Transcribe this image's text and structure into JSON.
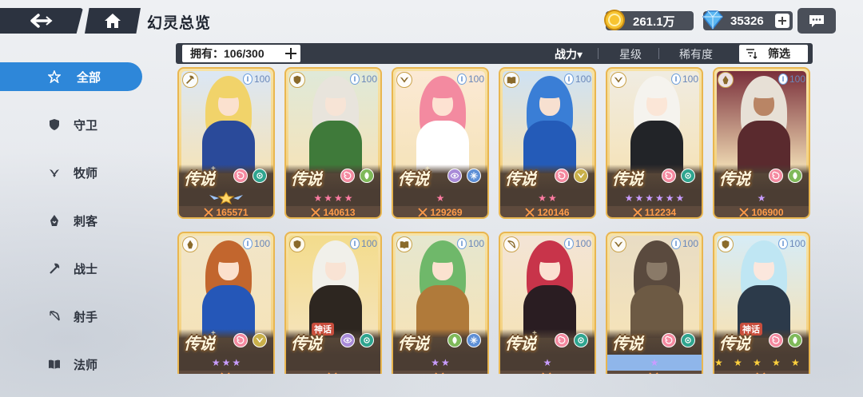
{
  "header": {
    "title": "幻灵总览",
    "gold": "261.1万",
    "gems": "35326"
  },
  "sidebar": {
    "items": [
      {
        "label": "全部",
        "icon": "all-star-icon",
        "active": true
      },
      {
        "label": "守卫",
        "icon": "shield-icon",
        "active": false
      },
      {
        "label": "牧师",
        "icon": "wing-icon",
        "active": false
      },
      {
        "label": "刺客",
        "icon": "assassin-icon",
        "active": false
      },
      {
        "label": "战士",
        "icon": "axe-icon",
        "active": false
      },
      {
        "label": "射手",
        "icon": "bow-icon",
        "active": false
      },
      {
        "label": "法师",
        "icon": "book-icon",
        "active": false
      }
    ]
  },
  "filterbar": {
    "own_label": "拥有：",
    "own_value": "106/300",
    "sort_power": "战力▾",
    "sort_star": "星级",
    "sort_rarity": "稀有度",
    "filter_label": "筛选"
  },
  "cards": [
    {
      "level": "100",
      "rarity": "传说",
      "sup": "+",
      "myth": "",
      "power": "165571",
      "stars": 0,
      "star_color": "gold",
      "star_bar": "dark",
      "elems": [
        "spiral",
        "orb"
      ],
      "class_icon": "axe-icon",
      "badge": true,
      "art": {
        "bg": "#dbe7f5",
        "hair": "#f1d36a",
        "skin": "#fbe1cf",
        "outfit": "#2a4a9a"
      }
    },
    {
      "level": "100",
      "rarity": "传说",
      "sup": "",
      "myth": "",
      "power": "140613",
      "stars": 4,
      "star_color": "pink",
      "star_bar": "dark",
      "elems": [
        "spiral",
        "leaf"
      ],
      "class_icon": "shield-icon",
      "badge": false,
      "art": {
        "bg": "#dfe9d9",
        "hair": "#e8e4dc",
        "skin": "#f7e4d6",
        "outfit": "#3f7a3a"
      }
    },
    {
      "level": "100",
      "rarity": "传说",
      "sup": "+",
      "myth": "",
      "power": "129269",
      "stars": 1,
      "star_color": "pink",
      "star_bar": "dark",
      "elems": [
        "eye",
        "snow"
      ],
      "class_icon": "wing-icon",
      "badge": false,
      "art": {
        "bg": "#fbe9d5",
        "hair": "#f38aa0",
        "skin": "#fde2d2",
        "outfit": "#ffffff"
      }
    },
    {
      "level": "100",
      "rarity": "传说",
      "sup": "",
      "myth": "",
      "power": "120146",
      "stars": 2,
      "star_color": "pink",
      "star_bar": "dark",
      "elems": [
        "spiral",
        "wing"
      ],
      "class_icon": "book-icon",
      "badge": false,
      "art": {
        "bg": "#cfe2f3",
        "hair": "#3a7ed6",
        "skin": "#f7e0d0",
        "outfit": "#245bb8"
      }
    },
    {
      "level": "100",
      "rarity": "传说",
      "sup": "",
      "myth": "",
      "power": "112234",
      "stars": 6,
      "star_color": "purple",
      "star_bar": "dark",
      "elems": [
        "spiral",
        "orb"
      ],
      "class_icon": "wing-icon",
      "badge": false,
      "art": {
        "bg": "#f0ece2",
        "hair": "#f5f3ee",
        "skin": "#fbe6d7",
        "outfit": "#222428"
      }
    },
    {
      "level": "100",
      "rarity": "传说",
      "sup": "",
      "myth": "",
      "power": "106900",
      "stars": 1,
      "star_color": "purple",
      "star_bar": "dark",
      "elems": [
        "spiral",
        "leaf"
      ],
      "class_icon": "assassin-icon",
      "badge": false,
      "art": {
        "bg": "#7a2f3b",
        "hair": "#e7e0d6",
        "skin": "#b98565",
        "outfit": "#5a2a2e"
      }
    },
    {
      "level": "100",
      "rarity": "传说",
      "sup": "+",
      "myth": "",
      "power": "",
      "stars": 3,
      "star_color": "purple",
      "star_bar": "dark",
      "elems": [
        "spiral",
        "wing"
      ],
      "class_icon": "assassin-icon",
      "badge": false,
      "art": {
        "bg": "#f1e5c8",
        "hair": "#c2662e",
        "skin": "#fbe0cc",
        "outfit": "#2557b8"
      }
    },
    {
      "level": "100",
      "rarity": "传说",
      "sup": "",
      "myth": "神话",
      "power": "",
      "stars": 0,
      "star_color": "purple",
      "star_bar": "dark",
      "elems": [
        "eye",
        "orb"
      ],
      "class_icon": "shield-icon",
      "badge": false,
      "art": {
        "bg": "#f3dc8c",
        "hair": "#f1f0ea",
        "skin": "#f9e3d4",
        "outfit": "#2d2620"
      }
    },
    {
      "level": "100",
      "rarity": "传说",
      "sup": "",
      "myth": "",
      "power": "",
      "stars": 2,
      "star_color": "purple",
      "star_bar": "dark",
      "elems": [
        "leaf",
        "snow"
      ],
      "class_icon": "book-icon",
      "badge": false,
      "art": {
        "bg": "#e5e7cf",
        "hair": "#6fb86a",
        "skin": "#fbe2cf",
        "outfit": "#b07a3a"
      }
    },
    {
      "level": "100",
      "rarity": "传说",
      "sup": "+",
      "myth": "",
      "power": "",
      "stars": 1,
      "star_color": "purple",
      "star_bar": "dark",
      "elems": [
        "spiral",
        "orb"
      ],
      "class_icon": "bow-icon",
      "badge": false,
      "art": {
        "bg": "#f3e4d6",
        "hair": "#c8344a",
        "skin": "#fbe1d1",
        "outfit": "#2a1d22"
      }
    },
    {
      "level": "100",
      "rarity": "传说",
      "sup": "",
      "myth": "",
      "power": "",
      "stars": 1,
      "star_color": "purple",
      "star_bar": "blue",
      "elems": [
        "spiral",
        "orb"
      ],
      "class_icon": "wing-icon",
      "badge": false,
      "art": {
        "bg": "#e8dcc4",
        "hair": "#5a4a3e",
        "skin": "#8a7a68",
        "outfit": "#6d5a44"
      }
    },
    {
      "level": "100",
      "rarity": "传说",
      "sup": "",
      "myth": "神话",
      "power": "",
      "stars": 5,
      "star_color": "gold",
      "star_bar": "dark",
      "elems": [
        "spiral",
        "leaf"
      ],
      "class_icon": "shield-icon",
      "badge": false,
      "art": {
        "bg": "#d6ecf7",
        "hair": "#bfe6f3",
        "skin": "#fbe7dd",
        "outfit": "#2c3a4a"
      }
    }
  ],
  "colors": {
    "accent": "#2e87d9",
    "dark_bar": "#2c3340",
    "card_border": "#e9b650",
    "power_text": "#ff9b49"
  }
}
